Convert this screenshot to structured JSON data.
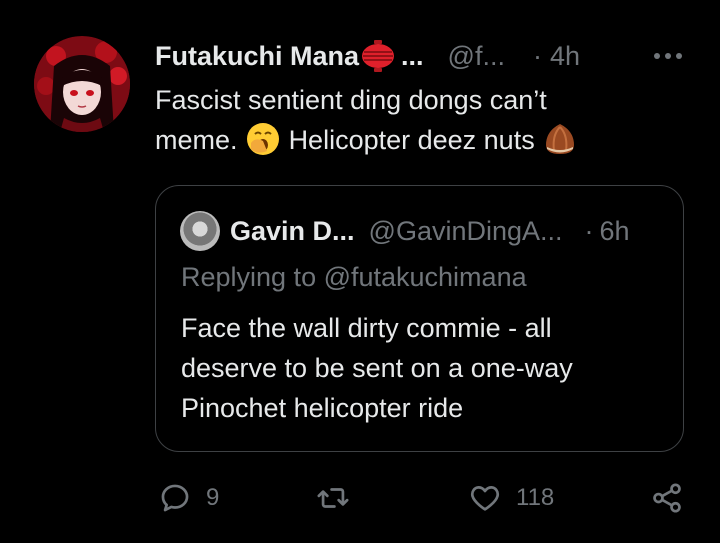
{
  "tweet": {
    "display_name": "Futakuchi Mana",
    "name_truncation": "...",
    "handle": "@f...",
    "separator": "·",
    "time": "4h",
    "text_line1": "Fascist sentient ding dongs can’t",
    "text_line2_a": "meme.",
    "text_line2_b": "Helicopter deez nuts",
    "emojis": [
      "yawning-face-emoji",
      "chestnut-emoji"
    ],
    "badge_icon": "red-lantern-badge-icon"
  },
  "quote": {
    "display_name": "Gavin D...",
    "handle": "@GavinDingA...",
    "separator": "·",
    "time": "6h",
    "replying_to": "Replying to @futakuchimana",
    "text_line1": "Face the wall dirty commie - all",
    "text_line2": "deserve to be sent on a one-way",
    "text_line3": "Pinochet helicopter ride"
  },
  "actions": {
    "reply_count": "9",
    "retweet_count": "",
    "like_count": "118"
  },
  "colors": {
    "background": "#000000",
    "text_primary": "#e7e9ea",
    "text_secondary": "#71767b",
    "border": "#3e4144"
  }
}
